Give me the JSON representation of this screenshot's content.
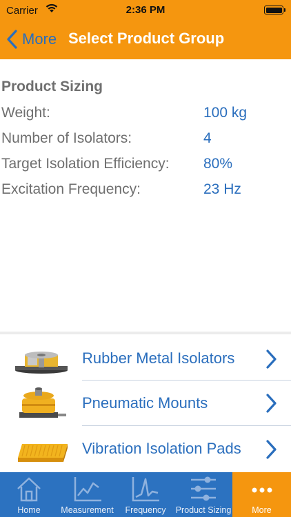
{
  "status_bar": {
    "carrier": "Carrier",
    "time": "2:36 PM"
  },
  "nav": {
    "back_label": "More",
    "title": "Select Product Group"
  },
  "sizing": {
    "title": "Product Sizing",
    "rows": [
      {
        "label": "Weight:",
        "value": "100 kg"
      },
      {
        "label": "Number of Isolators:",
        "value": "4"
      },
      {
        "label": "Target Isolation Efficiency:",
        "value": "80%"
      },
      {
        "label": "Excitation Frequency:",
        "value": "23 Hz"
      }
    ]
  },
  "products": [
    {
      "name": "Rubber Metal Isolators",
      "icon": "rubber-metal-isolator-image"
    },
    {
      "name": "Pneumatic Mounts",
      "icon": "pneumatic-mount-image"
    },
    {
      "name": "Vibration Isolation Pads",
      "icon": "vibration-pad-image"
    }
  ],
  "tabs": [
    {
      "label": "Home",
      "icon": "home-icon"
    },
    {
      "label": "Measurement",
      "icon": "measurement-chart-icon"
    },
    {
      "label": "Frequency",
      "icon": "frequency-chart-icon"
    },
    {
      "label": "Product Sizing",
      "icon": "sliders-icon"
    },
    {
      "label": "More",
      "icon": "more-dots-icon",
      "active": true
    }
  ],
  "colors": {
    "orange": "#f5960f",
    "blue": "#2c72c0",
    "link": "#2a6ebd",
    "gray_text": "#6f6f6f"
  }
}
